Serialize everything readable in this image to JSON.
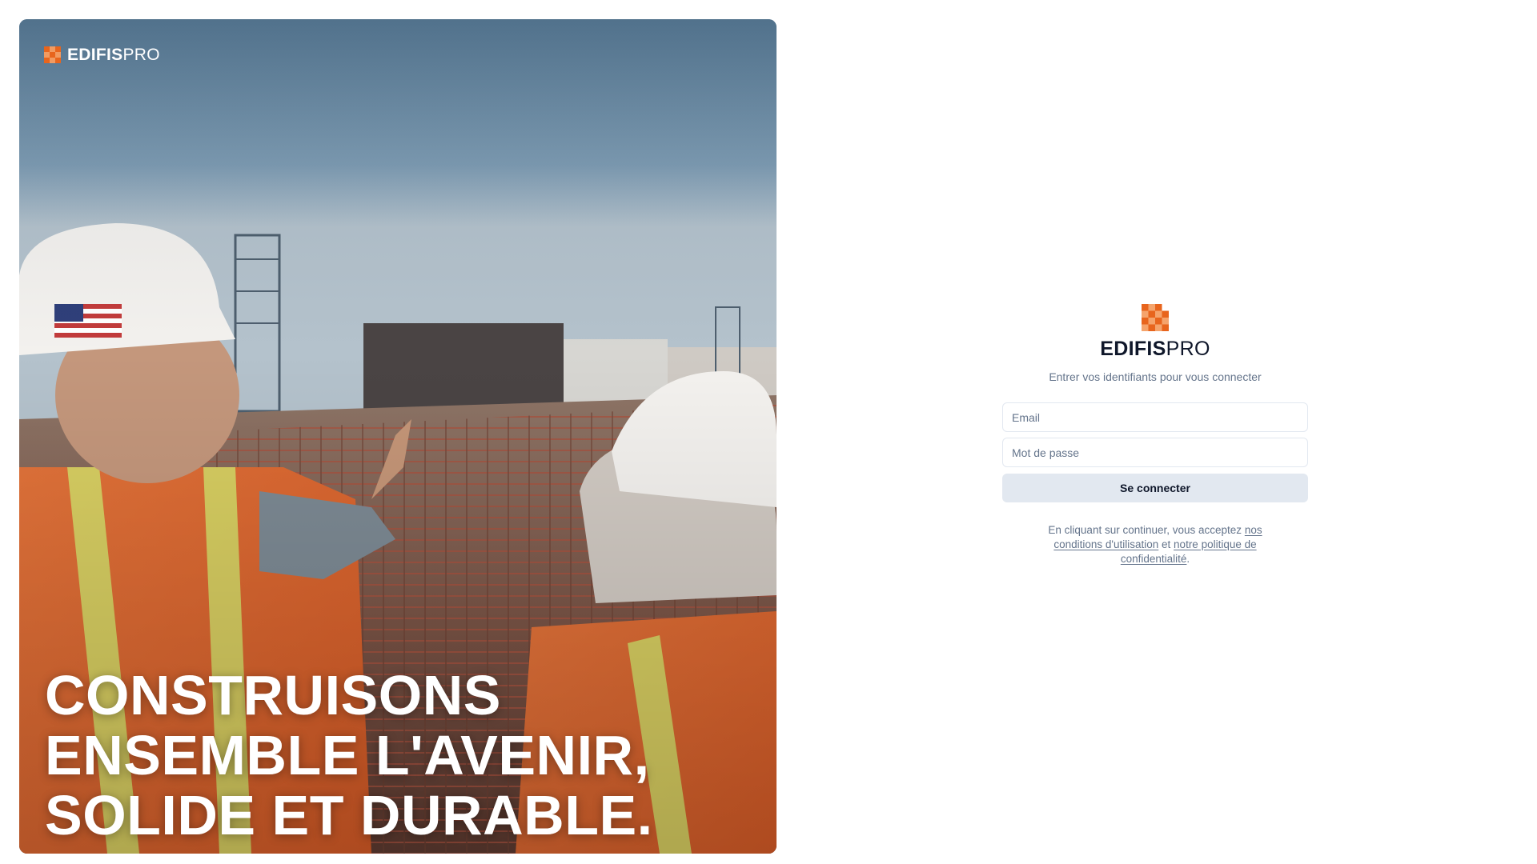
{
  "brand": {
    "name_strong": "EDIFIS",
    "name_light": "PRO",
    "accent_color": "#e8651d"
  },
  "hero": {
    "headline_lines": [
      "CONSTRUISONS",
      "ENSEMBLE L'AVENIR,",
      "SOLIDE ET DURABLE."
    ],
    "image_description_icon": "construction-site-photo"
  },
  "login": {
    "subtitle": "Entrer vos identifiants pour vous connecter",
    "email": {
      "placeholder": "Email",
      "value": ""
    },
    "password": {
      "placeholder": "Mot de passe",
      "value": ""
    },
    "submit_label": "Se connecter",
    "terms": {
      "prefix": "En cliquant sur continuer, vous acceptez ",
      "conditions_link": "nos conditions d'utilisation",
      "middle": " et ",
      "privacy_link": "notre politique de confidentialité",
      "suffix": "."
    }
  },
  "colors": {
    "button_bg": "#e2e8f0",
    "muted_text": "#64748b",
    "input_border": "#e2e8f0"
  }
}
